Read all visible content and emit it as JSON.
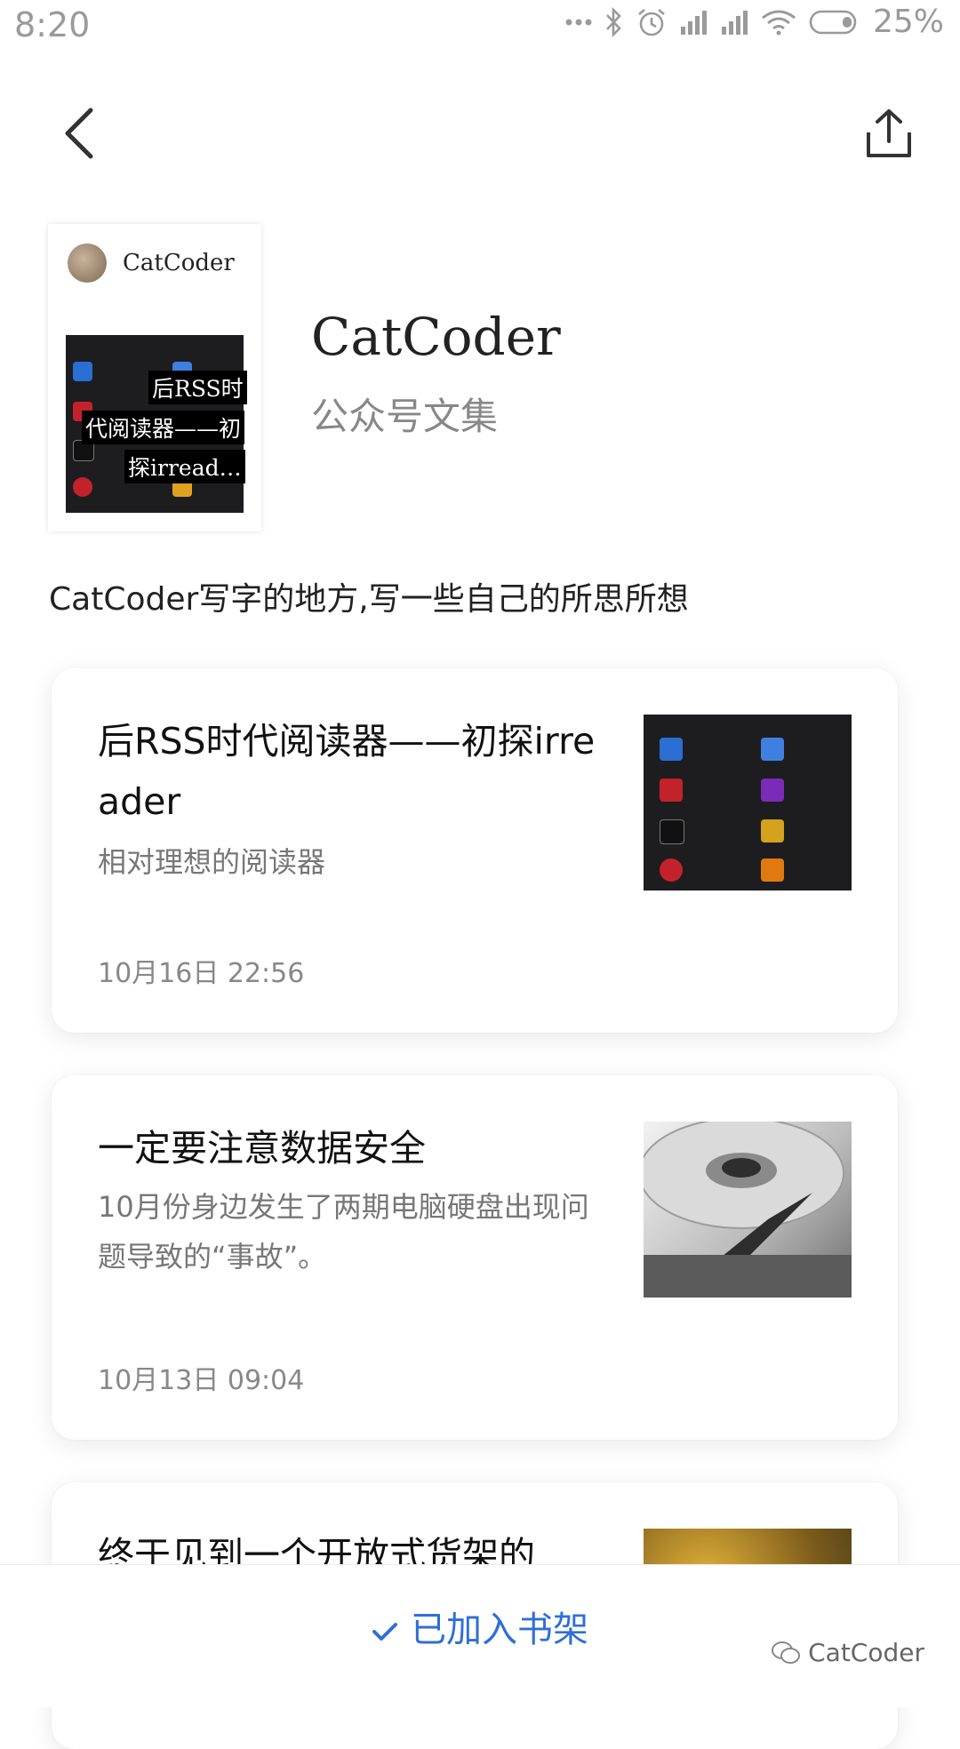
{
  "status_bar": {
    "time": "8:20",
    "battery": "25%",
    "icons": [
      "more-dots-icon",
      "bluetooth-icon",
      "alarm-icon",
      "signal-icon",
      "signal-icon",
      "wifi-icon",
      "battery-icon"
    ]
  },
  "header": {
    "back_icon": "back-arrow-icon",
    "share_icon": "share-icon"
  },
  "cover": {
    "account_name": "CatCoder",
    "title_lines": [
      "后RSS时",
      "代阅读器——初",
      "探irread…"
    ]
  },
  "collection": {
    "title": "CatCoder",
    "subtitle": "公众号文集",
    "description": "CatCoder写字的地方,写一些自己的所思所想"
  },
  "articles": [
    {
      "title": "后RSS时代阅读器——初探irreader",
      "summary": "相对理想的阅读器",
      "date": "10月16日 22:56"
    },
    {
      "title": "一定要注意数据安全",
      "summary": "10月份身边发生了两期电脑硬盘出现问题导致的“事故”。",
      "date": "10月13日 09:04"
    },
    {
      "title": "终于见到一个开放式货架的"
    }
  ],
  "bottom": {
    "button_label": "已加入书架",
    "watermark": "CatCoder"
  },
  "colors": {
    "accent": "#2f6fd6",
    "muted": "#888888"
  }
}
